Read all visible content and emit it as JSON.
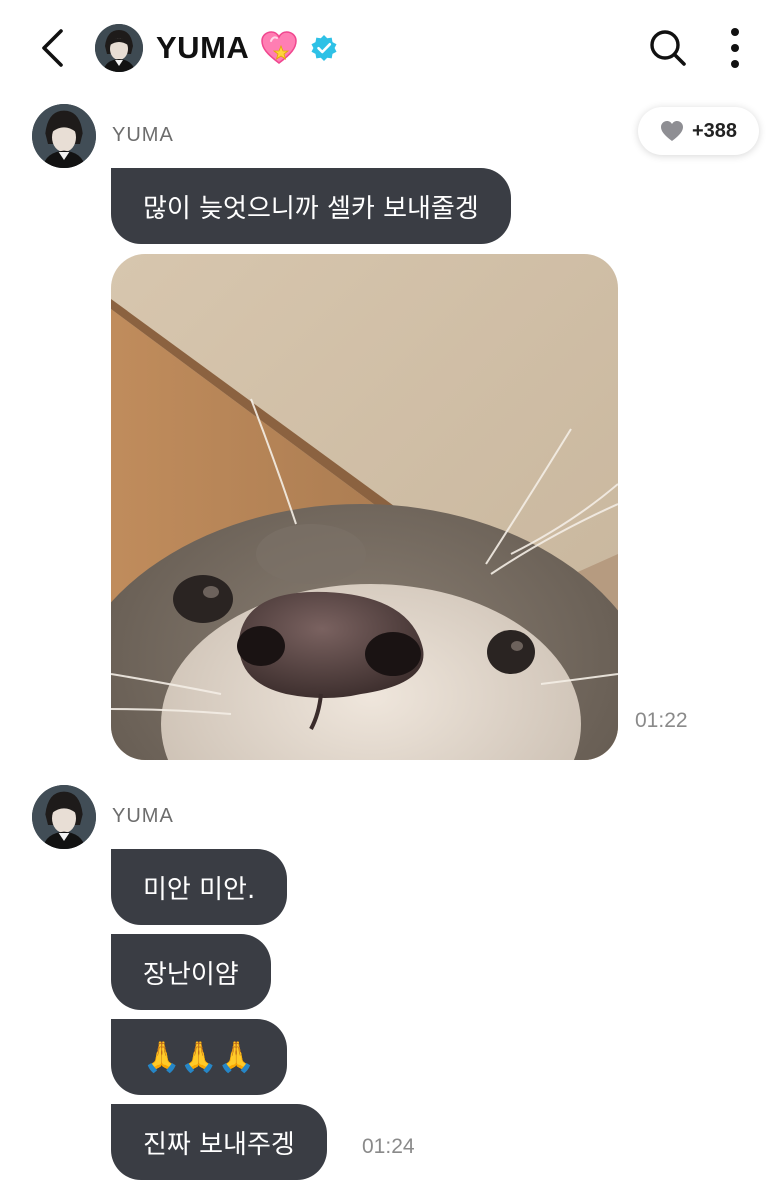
{
  "header": {
    "title": "YUMA",
    "accent_heart": "#ff6fa8",
    "verified_color": "#2ec1e6"
  },
  "reaction": {
    "count": "+388",
    "heart_color": "#8e8e93"
  },
  "messages": {
    "group1": {
      "sender": "YUMA",
      "text1": "많이 늦엇으니까 셀카 보내줄겡",
      "photo_icon": "otter-selfie-photo",
      "time": "01:22"
    },
    "group2": {
      "sender": "YUMA",
      "text1": "미안 미안.",
      "text2": "장난이얌",
      "text3": "🙏🙏🙏",
      "text4": "진짜 보내주겡",
      "time": "01:24"
    }
  },
  "colors": {
    "bubble": "#3a3d44",
    "background": "#ffffff"
  }
}
